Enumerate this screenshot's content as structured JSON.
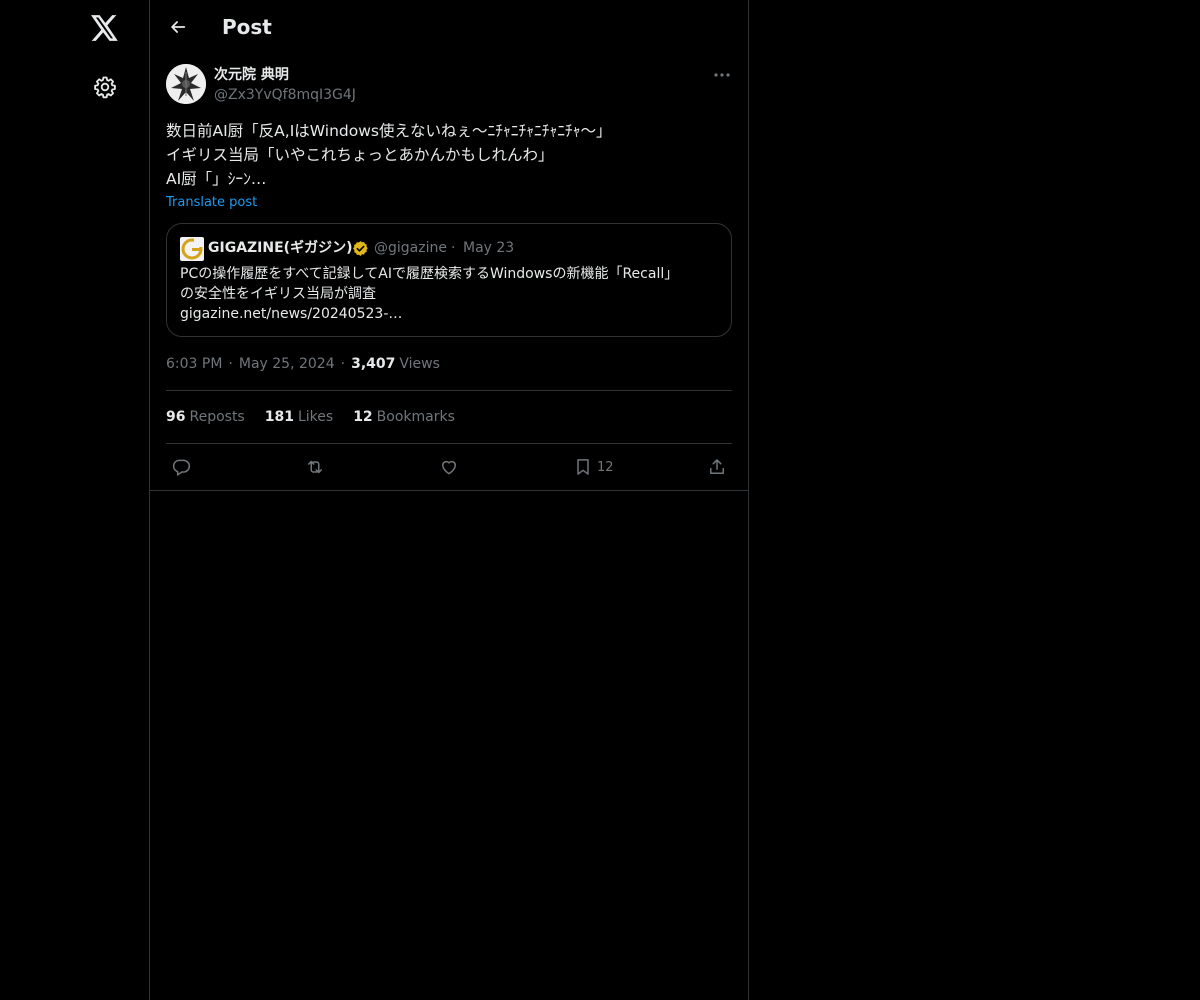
{
  "nav": {
    "logo_icon": "x-logo-icon",
    "settings_icon": "gear-icon"
  },
  "header": {
    "title": "Post",
    "back_icon": "arrow-left-icon"
  },
  "post": {
    "author_name": "次元院 典明",
    "author_handle": "@Zx3YvQf8mqI3G4J",
    "text_lines": [
      "数日前AI厨「反A,IはWindows使えないねぇ〜ﾆﾁｬﾆﾁｬﾆﾁｬﾆﾁｬ〜」",
      "イギリス当局「いやこれちょっとあかんかもしれんわ」",
      "AI厨「」ｼｰﾝ…"
    ],
    "translate_label": "Translate post",
    "quote": {
      "name": "GIGAZINE(ギガジン)",
      "handle": "@gigazine",
      "dot": "·",
      "date": "May 23",
      "text_lines": [
        "PCの操作履歴をすべて記録してAIで履歴検索するWindowsの新機能「Recall」",
        "の安全性をイギリス当局が調査",
        "gigazine.net/news/20240523-…"
      ]
    },
    "time": "6:03 PM",
    "dot": "·",
    "date": "May 25, 2024",
    "views_count": "3,407",
    "views_label": "Views",
    "stats": {
      "reposts_count": "96",
      "reposts_label": "Reposts",
      "likes_count": "181",
      "likes_label": "Likes",
      "bookmarks_count": "12",
      "bookmarks_label": "Bookmarks"
    },
    "actions": {
      "bookmark_count": "12"
    }
  },
  "colors": {
    "background": "#000000",
    "text": "#e7e9ea",
    "muted": "#71767b",
    "accent": "#1d9bf0",
    "border": "#2f3336",
    "verified_gold": "#e2b719"
  }
}
